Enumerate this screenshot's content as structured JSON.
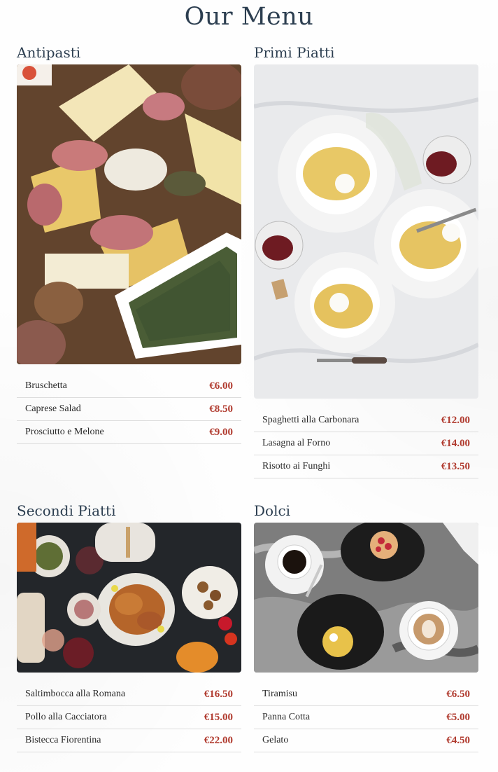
{
  "page": {
    "title": "Our Menu"
  },
  "sections": [
    {
      "name": "Antipasti",
      "items": [
        {
          "name": "Bruschetta",
          "price": "€6.00"
        },
        {
          "name": "Caprese Salad",
          "price": "€8.50"
        },
        {
          "name": "Prosciutto e Melone",
          "price": "€9.00"
        }
      ]
    },
    {
      "name": "Primi Piatti",
      "items": [
        {
          "name": "Spaghetti alla Carbonara",
          "price": "€12.00"
        },
        {
          "name": "Lasagna al Forno",
          "price": "€14.00"
        },
        {
          "name": "Risotto ai Funghi",
          "price": "€13.50"
        }
      ]
    },
    {
      "name": "Secondi Piatti",
      "items": [
        {
          "name": "Saltimbocca alla Romana",
          "price": "€16.50"
        },
        {
          "name": "Pollo alla Cacciatora",
          "price": "€15.00"
        },
        {
          "name": "Bistecca Fiorentina",
          "price": "€22.00"
        }
      ]
    },
    {
      "name": "Dolci",
      "items": [
        {
          "name": "Tiramisu",
          "price": "€6.50"
        },
        {
          "name": "Panna Cotta",
          "price": "€5.00"
        },
        {
          "name": "Gelato",
          "price": "€4.50"
        }
      ]
    }
  ],
  "colors": {
    "heading": "#2c3e50",
    "price": "#b03a2e",
    "divider": "#dcdcdc"
  }
}
